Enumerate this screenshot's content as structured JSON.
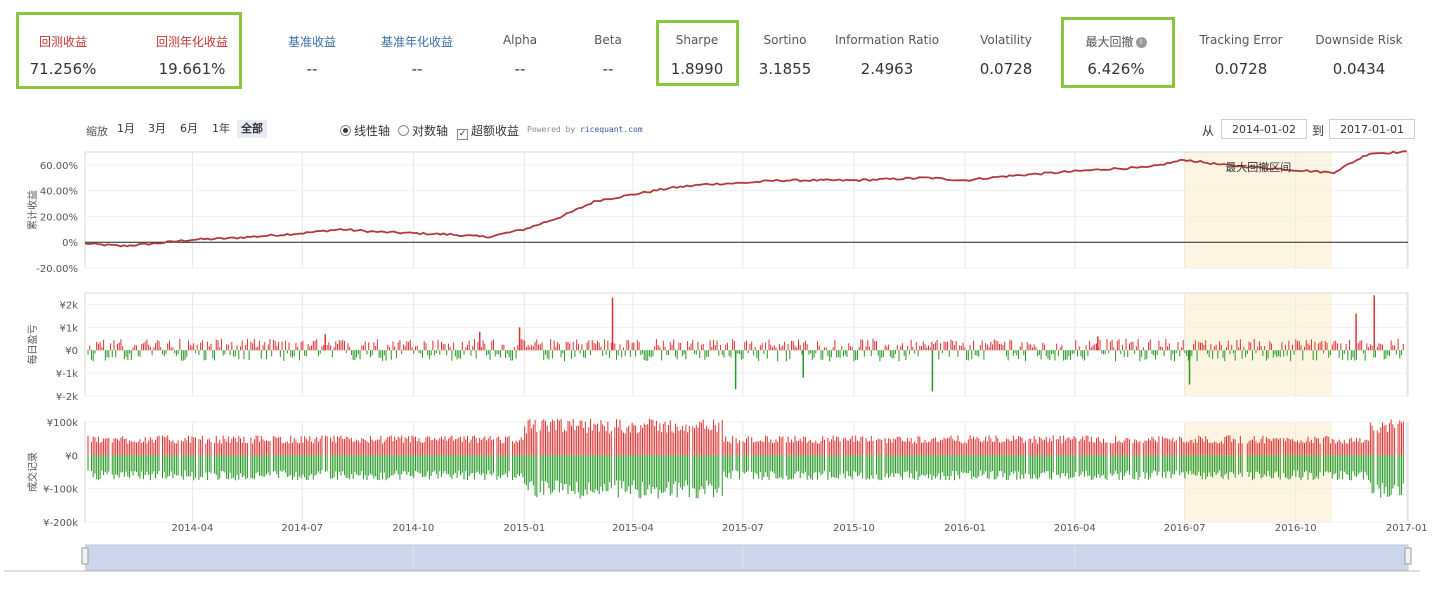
{
  "metrics": [
    {
      "label": "回测收益",
      "value": "71.256%",
      "style": "red"
    },
    {
      "label": "回测年化收益",
      "value": "19.661%",
      "style": "red"
    },
    {
      "label": "基准收益",
      "value": "--",
      "style": "blue"
    },
    {
      "label": "基准年化收益",
      "value": "--",
      "style": "blue"
    },
    {
      "label": "Alpha",
      "value": "--",
      "style": ""
    },
    {
      "label": "Beta",
      "value": "--",
      "style": ""
    },
    {
      "label": "Sharpe",
      "value": "1.8990",
      "style": ""
    },
    {
      "label": "Sortino",
      "value": "3.1855",
      "style": ""
    },
    {
      "label": "Information Ratio",
      "value": "2.4963",
      "style": ""
    },
    {
      "label": "Volatility",
      "value": "0.0728",
      "style": ""
    },
    {
      "label": "最大回撤",
      "value": "6.426%",
      "style": "",
      "icon": "info-icon"
    },
    {
      "label": "Tracking Error",
      "value": "0.0728",
      "style": ""
    },
    {
      "label": "Downside Risk",
      "value": "0.0434",
      "style": ""
    }
  ],
  "toolbar": {
    "zoom_label": "缩放",
    "zoom_buttons": [
      "1月",
      "3月",
      "6月",
      "1年",
      "全部"
    ],
    "zoom_selected": "全部",
    "axis_options": [
      {
        "label": "线性轴",
        "type": "radio",
        "checked": true
      },
      {
        "label": "对数轴",
        "type": "radio",
        "checked": false
      },
      {
        "label": "超额收益",
        "type": "checkbox",
        "checked": true
      }
    ],
    "powered_by": "Powered by",
    "powered_brand": "ricequant.com",
    "from_label": "从",
    "from_date": "2014-01-02",
    "to_label": "到",
    "to_date": "2017-01-01"
  },
  "colors": {
    "line": "#b03a3a",
    "profit": "#dd3333",
    "loss": "#229922",
    "highlight_box": "#8cc63f",
    "drawdown_band": "#fdf5e2",
    "navigator": "#ccd6eb"
  },
  "chart_data": [
    {
      "type": "line",
      "ylabel": "累计收益",
      "yticks": [
        "60.00%",
        "40.00%",
        "20.00%",
        "0%",
        "-20.00%"
      ],
      "ylim": [
        -20,
        70
      ],
      "annotation": "最大回撤区间",
      "annotation_range": [
        "2016-07-01",
        "2016-10-31"
      ],
      "x": [
        "2014-01-02",
        "2014-02-01",
        "2014-03-01",
        "2014-04-01",
        "2014-05-01",
        "2014-06-01",
        "2014-07-01",
        "2014-08-01",
        "2014-09-01",
        "2014-10-01",
        "2014-11-01",
        "2014-12-01",
        "2015-01-01",
        "2015-02-01",
        "2015-03-01",
        "2015-04-01",
        "2015-05-01",
        "2015-06-01",
        "2015-07-01",
        "2015-08-01",
        "2015-09-01",
        "2015-10-01",
        "2015-11-01",
        "2015-12-01",
        "2016-01-01",
        "2016-02-01",
        "2016-03-01",
        "2016-04-01",
        "2016-05-01",
        "2016-06-01",
        "2016-07-01",
        "2016-08-01",
        "2016-09-01",
        "2016-10-01",
        "2016-11-01",
        "2016-12-01",
        "2017-01-01"
      ],
      "values": [
        -1,
        -3,
        -1,
        2,
        3,
        5,
        7,
        10,
        8,
        7,
        6,
        4,
        10,
        20,
        32,
        37,
        42,
        45,
        46,
        48,
        48,
        48,
        49,
        50,
        48,
        51,
        53,
        55,
        57,
        58,
        64,
        60,
        58,
        56,
        54,
        69,
        70
      ]
    },
    {
      "type": "bar",
      "ylabel": "每日盈亏",
      "yticks": [
        "¥2k",
        "¥1k",
        "¥0",
        "¥-1k",
        "¥-2k"
      ],
      "ylim": [
        -2000,
        2500
      ],
      "spikes": [
        {
          "date": "2015-03-15",
          "value": 2300
        },
        {
          "date": "2016-11-20",
          "value": 1600
        },
        {
          "date": "2016-12-05",
          "value": 2400
        },
        {
          "date": "2015-06-25",
          "value": -1700
        },
        {
          "date": "2015-12-05",
          "value": -1800
        },
        {
          "date": "2015-08-20",
          "value": -1200
        },
        {
          "date": "2016-07-05",
          "value": -1500
        },
        {
          "date": "2014-07-20",
          "value": 700
        },
        {
          "date": "2014-11-25",
          "value": 800
        },
        {
          "date": "2014-12-28",
          "value": 1000
        },
        {
          "date": "2016-04-20",
          "value": 600
        }
      ]
    },
    {
      "type": "bar",
      "ylabel": "成交记录",
      "yticks": [
        "¥100k",
        "¥0",
        "¥-100k",
        "¥-200k"
      ],
      "ylim": [
        -200000,
        100000
      ]
    }
  ],
  "x_axis_ticks": [
    "2014-04",
    "2014-07",
    "2014-10",
    "2015-01",
    "2015-04",
    "2015-07",
    "2015-10",
    "2016-01",
    "2016-04",
    "2016-07",
    "2016-10",
    "2017-01"
  ]
}
